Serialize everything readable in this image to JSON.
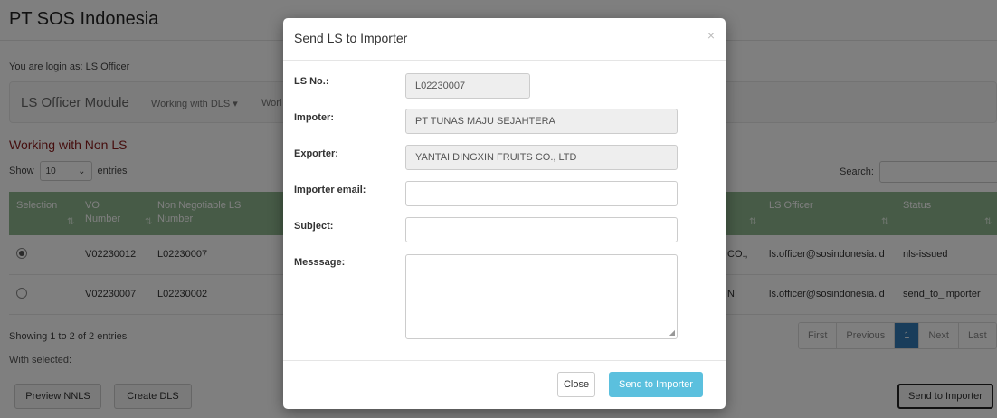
{
  "app": {
    "title": "PT SOS Indonesia",
    "login_text": "You are login as: LS Officer"
  },
  "navbar": {
    "module_title": "LS Officer Module",
    "item_dls": "Working with DLS",
    "item_truncated": "Worl"
  },
  "section": {
    "title": "Working with Non LS",
    "show_label": "Show",
    "entries_value": "10",
    "entries_label": "entries",
    "search_label": "Search:"
  },
  "table": {
    "headers": {
      "selection": "Selection",
      "vo_number_1": "VO",
      "vo_number_2": "Number",
      "nnls_1": "Non Negotiable LS",
      "nnls_2": "Number",
      "ls_officer": "LS Officer",
      "status": "Status"
    },
    "rows": [
      {
        "selected": true,
        "vo": "V02230012",
        "nnls": "L02230007",
        "exporter_fragment": "CO.,",
        "officer": "ls.officer@sosindonesia.id",
        "status": "nls-issued"
      },
      {
        "selected": false,
        "vo": "V02230007",
        "nnls": "L02230002",
        "exporter_fragment": "N",
        "officer": "ls.officer@sosindonesia.id",
        "status": "send_to_importer"
      }
    ]
  },
  "footer": {
    "showing": "Showing 1 to 2 of 2 entries",
    "with_selected": "With selected:",
    "preview_btn": "Preview NNLS",
    "create_btn": "Create DLS",
    "send_btn": "Send to Importer"
  },
  "pagination": {
    "first": "First",
    "previous": "Previous",
    "current": "1",
    "next": "Next",
    "last": "Last"
  },
  "modal": {
    "title": "Send LS to Importer",
    "close_x": "×",
    "ls_no_label": "LS No.:",
    "ls_no_value": "L02230007",
    "importer_label": "Impoter:",
    "importer_value": "PT TUNAS MAJU SEJAHTERA",
    "exporter_label": "Exporter:",
    "exporter_value": "YANTAI DINGXIN FRUITS CO., LTD",
    "email_label": "Importer email:",
    "email_value": "",
    "subject_label": "Subject:",
    "subject_value": "",
    "message_label": "Messsage:",
    "close_btn": "Close",
    "send_btn": "Send to Importer"
  },
  "colors": {
    "table_header": "#8fb68f",
    "section_title": "#8b1a1a",
    "send_button": "#5bc0de",
    "pager_active": "#337ab7"
  },
  "icons": {
    "dropdown": "caret-down-icon",
    "sort": "sort-icon",
    "close": "close-icon",
    "resize": "resize-grip-icon"
  }
}
